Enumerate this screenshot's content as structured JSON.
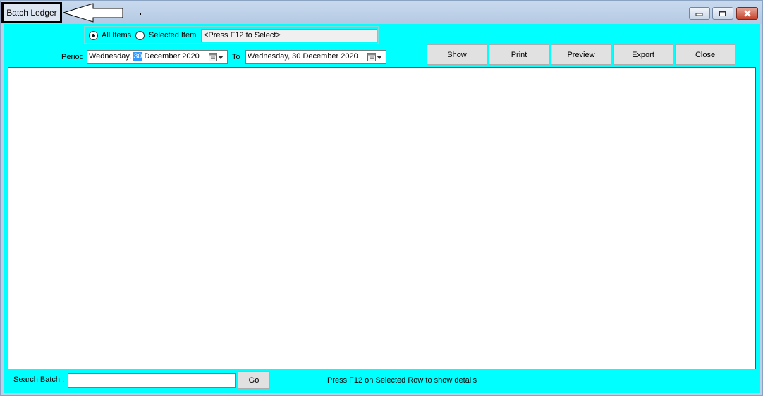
{
  "window": {
    "title": "Batch Ledger",
    "controls": {
      "minimize": "minimize-icon",
      "maximize": "maximize-icon",
      "close": "close-icon"
    }
  },
  "filter": {
    "all_items_label": "All Items",
    "all_items_selected": true,
    "selected_item_label": "Selected Item",
    "selected_item_selected": false,
    "item_value": "<Press F12 to Select>"
  },
  "period": {
    "label": "Period",
    "from_prefix": "Wednesday, ",
    "from_day": "30",
    "from_suffix": " December 2020",
    "to_label": "To",
    "to_value": "Wednesday, 30 December 2020"
  },
  "toolbar": {
    "show": "Show",
    "print": "Print",
    "preview": "Preview",
    "export": "Export",
    "close": "Close"
  },
  "footer": {
    "search_label": "Search Batch :",
    "search_value": "",
    "go": "Go",
    "hint": "Press F12 on Selected Row to show details"
  },
  "colors": {
    "client_bg": "#00ffff",
    "selection": "#3399ff"
  }
}
